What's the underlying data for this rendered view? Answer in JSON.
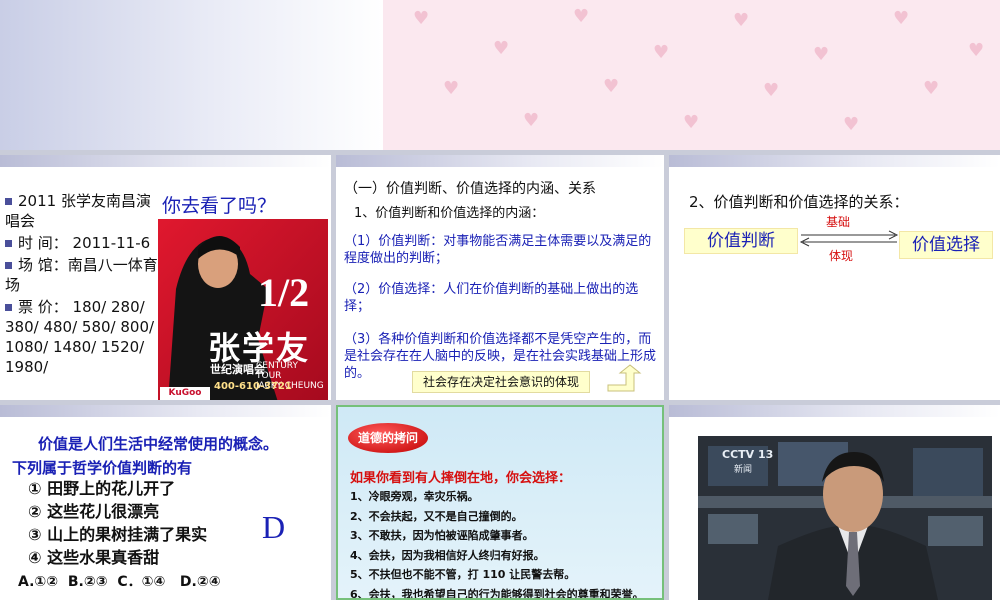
{
  "slide_concert": {
    "question": "你去看了吗？",
    "items": [
      "2011 张学友南昌演唱会",
      "时 间： 2011-11-6",
      "场 馆：南昌八一体育场",
      "票 价： 180/ 280/ 380/ 480/ 580/ 800/ 1080/ 1480/ 1520/ 1980/"
    ],
    "poster": {
      "fraction": "1/2",
      "name": "张学友",
      "tour_cn": "世纪演唱会",
      "tour_en_1": "CENTURY TOUR",
      "tour_en_2": "JACKY CHEUNG",
      "phone": "400-610-3721",
      "brand": "KuGoo"
    }
  },
  "slide_concept": {
    "heading": "（一）价值判断、价值选择的内涵、关系",
    "sub": "1、价值判断和价值选择的内涵：",
    "p1": "（1）价值判断：对事物能否满足主体需要以及满足的程度做出的判断；",
    "p2": "（2）价值选择：人们在价值判断的基础上做出的选择；",
    "p3": "（3）各种价值判断和价值选择都不是凭空产生的，而是社会存在在人脑中的反映，是在社会实践基础上形成的。",
    "callout": "社会存在决定社会意识的体现"
  },
  "slide_relation": {
    "heading": "2、价值判断和价值选择的关系：",
    "left_box": "价值判断",
    "right_box": "价值选择",
    "top_arrow_label": "基础",
    "bottom_arrow_label": "体现"
  },
  "slide_quiz": {
    "line1": "价值是人们生活中经常使用的概念。",
    "line2": "下列属于哲学价值判断的有",
    "options": [
      "① 田野上的花儿开了",
      "② 这些花儿很漂亮",
      "③ 山上的果树挂满了果实",
      "④ 这些水果真香甜"
    ],
    "choices": "A.①②  B.②③  C．①④   D.②④",
    "answer": "D"
  },
  "slide_dilemma": {
    "badge": "道德的拷问",
    "question": "如果你看到有人摔倒在地，你会选择：",
    "options": [
      "1、冷眼旁观，幸灾乐祸。",
      "2、不会扶起，又不是自己撞倒的。",
      "3、不敢扶，因为怕被诬陷成肇事者。",
      "4、会扶，因为我相信好人终归有好报。",
      "5、不扶但也不能不管，打 110 让民警去帮。",
      "6、会扶，我也希望自己的行为能够得到社会的尊重和荣誉。"
    ]
  },
  "slide_news": {
    "channel_logo": "CCTV 13",
    "channel_sub": "新闻"
  },
  "colors": {
    "accent_blue": "#1a21b5",
    "accent_red": "#d60f0f",
    "poster_red": "#c8102e",
    "callout_yellow": "#ffffcc"
  }
}
